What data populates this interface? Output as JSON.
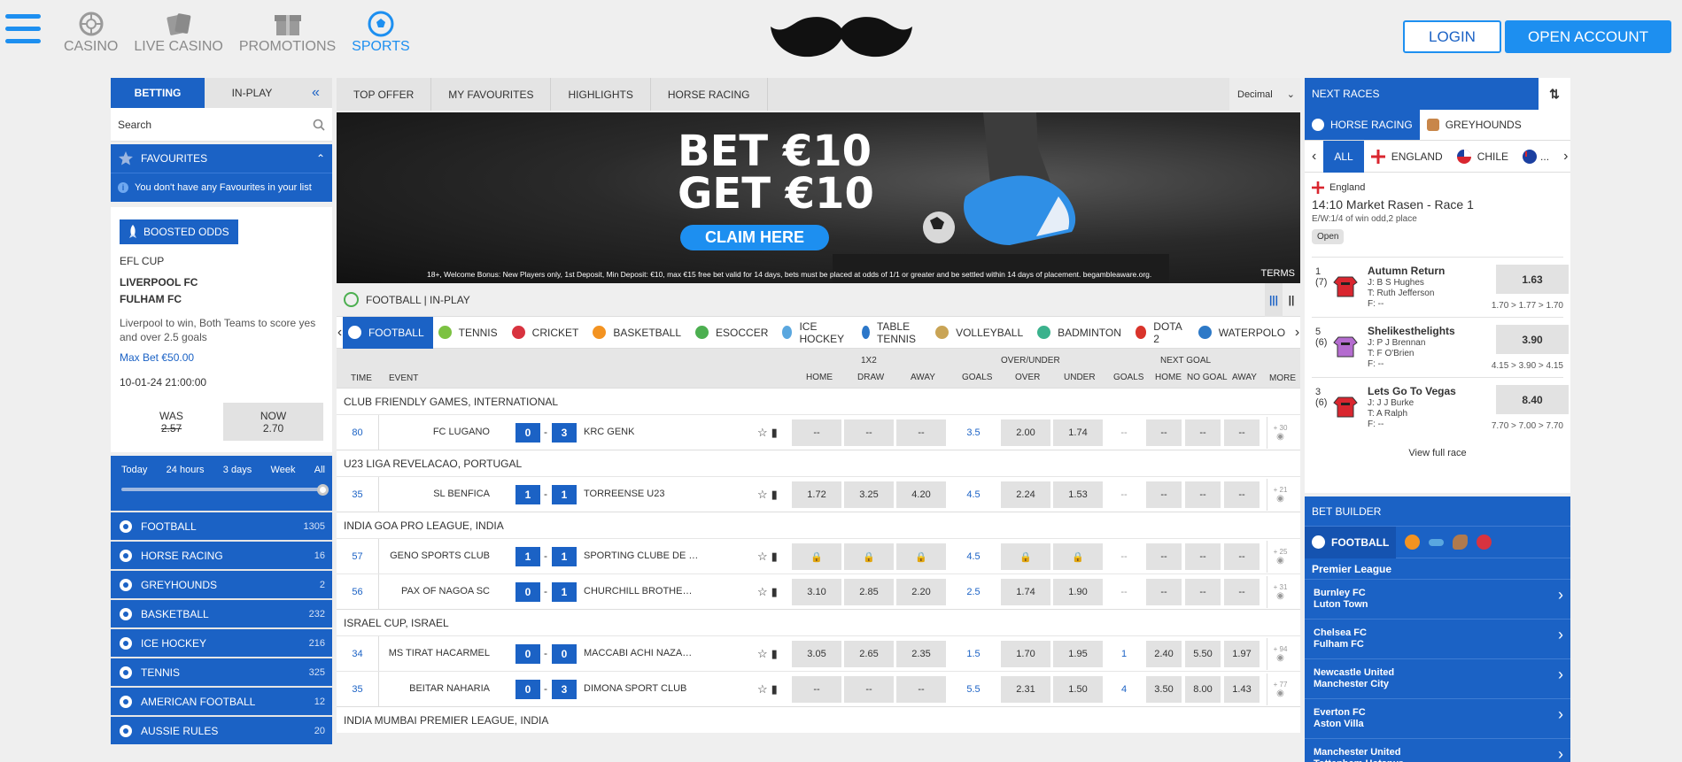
{
  "header": {
    "nav": [
      {
        "label": "CASINO"
      },
      {
        "label": "LIVE CASINO"
      },
      {
        "label": "PROMOTIONS"
      },
      {
        "label": "SPORTS"
      }
    ],
    "login": "LOGIN",
    "open_account": "OPEN ACCOUNT",
    "accent": "#1d8ff0"
  },
  "left": {
    "tab_betting": "BETTING",
    "tab_inplay": "IN-PLAY",
    "collapse": "«",
    "search_placeholder": "Search",
    "favourites": "FAVOURITES",
    "fav_msg": "You don't have any Favourites in your list",
    "boost": {
      "label": "BOOSTED ODDS",
      "competition": "EFL CUP",
      "team1": "LIVERPOOL FC",
      "team2": "FULHAM FC",
      "desc": "Liverpool to win, Both Teams to score yes and over 2.5 goals",
      "max_bet": "Max Bet €50.00",
      "datetime": "10-01-24 21:00:00",
      "was_label": "WAS",
      "was_value": "2.57",
      "now_label": "NOW",
      "now_value": "2.70"
    },
    "time_filters": [
      "Today",
      "24 hours",
      "3 days",
      "Week",
      "All"
    ],
    "slider_value": 1.0,
    "sports": [
      {
        "label": "FOOTBALL",
        "count": "1305",
        "icon": "football-icon"
      },
      {
        "label": "HORSE RACING",
        "count": "16",
        "icon": "horse-icon"
      },
      {
        "label": "GREYHOUNDS",
        "count": "2",
        "icon": "greyhound-icon"
      },
      {
        "label": "BASKETBALL",
        "count": "232",
        "icon": "basketball-icon"
      },
      {
        "label": "ICE HOCKEY",
        "count": "216",
        "icon": "ice-hockey-icon"
      },
      {
        "label": "TENNIS",
        "count": "325",
        "icon": "tennis-icon"
      },
      {
        "label": "AMERICAN FOOTBALL",
        "count": "12",
        "icon": "american-football-icon"
      },
      {
        "label": "AUSSIE RULES",
        "count": "20",
        "icon": "aussie-rules-icon"
      }
    ]
  },
  "center": {
    "tabs": [
      "TOP OFFER",
      "MY FAVOURITES",
      "HIGHLIGHTS",
      "HORSE RACING"
    ],
    "odds_format": "Decimal",
    "banner": {
      "line1": "BET €10",
      "line2": "GET €10",
      "cta": "CLAIM HERE",
      "fine": "18+, Welcome Bonus: New Players only, 1st Deposit, Min Deposit: €10, max €15 free bet valid for 14 days, bets must be placed at odds of 1/1 or greater and be settled within 14 days of placement. begambleaware.org.",
      "terms": "TERMS"
    },
    "section_title": "FOOTBALL | IN-PLAY",
    "sport_tabs": [
      {
        "label": "FOOTBALL",
        "color": "#1b62c5"
      },
      {
        "label": "TENNIS",
        "color": "#7cc242"
      },
      {
        "label": "CRICKET",
        "color": "#d8333f"
      },
      {
        "label": "BASKETBALL",
        "color": "#f39321"
      },
      {
        "label": "ESOCCER",
        "color": "#4caf50"
      },
      {
        "label": "ICE HOCKEY",
        "color": "#5aa7df"
      },
      {
        "label": "TABLE TENNIS",
        "color": "#2c77c9"
      },
      {
        "label": "VOLLEYBALL",
        "color": "#c9a455"
      },
      {
        "label": "BADMINTON",
        "color": "#3bb28d"
      },
      {
        "label": "DOTA 2",
        "color": "#d9342b"
      },
      {
        "label": "WATERPOLO",
        "color": "#2d79c7"
      }
    ],
    "columns": {
      "time": "TIME",
      "event": "EVENT",
      "g1": "1X2",
      "home": "HOME",
      "draw": "DRAW",
      "away": "AWAY",
      "g2": "OVER/UNDER",
      "goals": "GOALS",
      "over": "OVER",
      "under": "UNDER",
      "g3": "NEXT GOAL",
      "goals2": "GOALS",
      "home2": "HOME",
      "nogoal": "NO GOAL",
      "away2": "AWAY",
      "more": "MORE"
    },
    "competitions": [
      {
        "name": "CLUB FRIENDLY GAMES, INTERNATIONAL",
        "matches": [
          {
            "time": "80",
            "home": "FC LUGANO",
            "hs": "0",
            "as": "3",
            "away": "KRC GENK",
            "h": "--",
            "d": "--",
            "a": "--",
            "goals": "3.5",
            "over": "2.00",
            "under": "1.74",
            "ng": "--",
            "nh": "--",
            "nn": "--",
            "na": "--",
            "more": "+ 30"
          }
        ]
      },
      {
        "name": "U23 LIGA REVELACAO, PORTUGAL",
        "matches": [
          {
            "time": "35",
            "home": "SL BENFICA",
            "hs": "1",
            "as": "1",
            "away": "TORREENSE U23",
            "h": "1.72",
            "d": "3.25",
            "a": "4.20",
            "goals": "4.5",
            "over": "2.24",
            "under": "1.53",
            "ng": "--",
            "nh": "--",
            "nn": "--",
            "na": "--",
            "more": "+ 21"
          }
        ]
      },
      {
        "name": "INDIA GOA PRO LEAGUE, INDIA",
        "matches": [
          {
            "time": "57",
            "home": "GENO SPORTS CLUB",
            "hs": "1",
            "as": "1",
            "away": "SPORTING CLUBE DE GOA",
            "h": "🔒",
            "d": "🔒",
            "a": "🔒",
            "goals": "4.5",
            "over": "🔒",
            "under": "🔒",
            "ng": "--",
            "nh": "--",
            "nn": "--",
            "na": "--",
            "more": "+ 25"
          },
          {
            "time": "56",
            "home": "PAX OF NAGOA SC",
            "hs": "0",
            "as": "1",
            "away": "CHURCHILL BROTHERS R...",
            "h": "3.10",
            "d": "2.85",
            "a": "2.20",
            "goals": "2.5",
            "over": "1.74",
            "under": "1.90",
            "ng": "--",
            "nh": "--",
            "nn": "--",
            "na": "--",
            "more": "+ 31"
          }
        ]
      },
      {
        "name": "ISRAEL CUP, ISRAEL",
        "matches": [
          {
            "time": "34",
            "home": "MS TIRAT HACARMEL",
            "hs": "0",
            "as": "0",
            "away": "MACCABI ACHI NAZARET...",
            "h": "3.05",
            "d": "2.65",
            "a": "2.35",
            "goals": "1.5",
            "over": "1.70",
            "under": "1.95",
            "ng": "1",
            "nh": "2.40",
            "nn": "5.50",
            "na": "1.97",
            "more": "+ 94"
          },
          {
            "time": "35",
            "home": "BEITAR NAHARIA",
            "hs": "0",
            "as": "3",
            "away": "DIMONA SPORT CLUB",
            "h": "--",
            "d": "--",
            "a": "--",
            "goals": "5.5",
            "over": "2.31",
            "under": "1.50",
            "ng": "4",
            "nh": "3.50",
            "nn": "8.00",
            "na": "1.43",
            "more": "+ 77"
          }
        ]
      },
      {
        "name": "INDIA MUMBAI PREMIER LEAGUE, INDIA",
        "matches": []
      }
    ]
  },
  "right": {
    "next_races": "NEXT RACES",
    "tab_horse": "HORSE RACING",
    "tab_grey": "GREYHOUNDS",
    "countries": [
      "ALL",
      "ENGLAND",
      "CHILE",
      "..."
    ],
    "race": {
      "country": "England",
      "title": "14:10  Market Rasen - Race 1",
      "ew": "E/W:1/4 of win odd,2 place",
      "status": "Open"
    },
    "runners": [
      {
        "num": "1",
        "draw": "(7)",
        "name": "Autumn Return",
        "jockey": "J: B S Hughes",
        "trainer": "T: Ruth Jefferson",
        "form": "F: --",
        "odds": "1.63",
        "hist": "1.70 > 1.77 > 1.70",
        "silk": "#d9262f"
      },
      {
        "num": "5",
        "draw": "(6)",
        "name": "Shelikesthelights",
        "jockey": "J: P J Brennan",
        "trainer": "T: F O'Brien",
        "form": "F: --",
        "odds": "3.90",
        "hist": "4.15 > 3.90 > 4.15",
        "silk": "#b46ccf"
      },
      {
        "num": "3",
        "draw": "(6)",
        "name": "Lets Go To Vegas",
        "jockey": "J: J J Burke",
        "trainer": "T: A Ralph",
        "form": "F: --",
        "odds": "8.40",
        "hist": "7.70 > 7.00 > 7.70",
        "silk": "#d9262f"
      }
    ],
    "view_full": "View full race",
    "bet_builder": "BET BUILDER",
    "bb_tab": "FOOTBALL",
    "league": "Premier League",
    "bb_matches": [
      {
        "t1": "Burnley FC",
        "t2": "Luton Town"
      },
      {
        "t1": "Chelsea FC",
        "t2": "Fulham FC"
      },
      {
        "t1": "Newcastle United",
        "t2": "Manchester City"
      },
      {
        "t1": "Everton FC",
        "t2": "Aston Villa"
      },
      {
        "t1": "Manchester United",
        "t2": "Tottenham Hotspur"
      }
    ]
  }
}
